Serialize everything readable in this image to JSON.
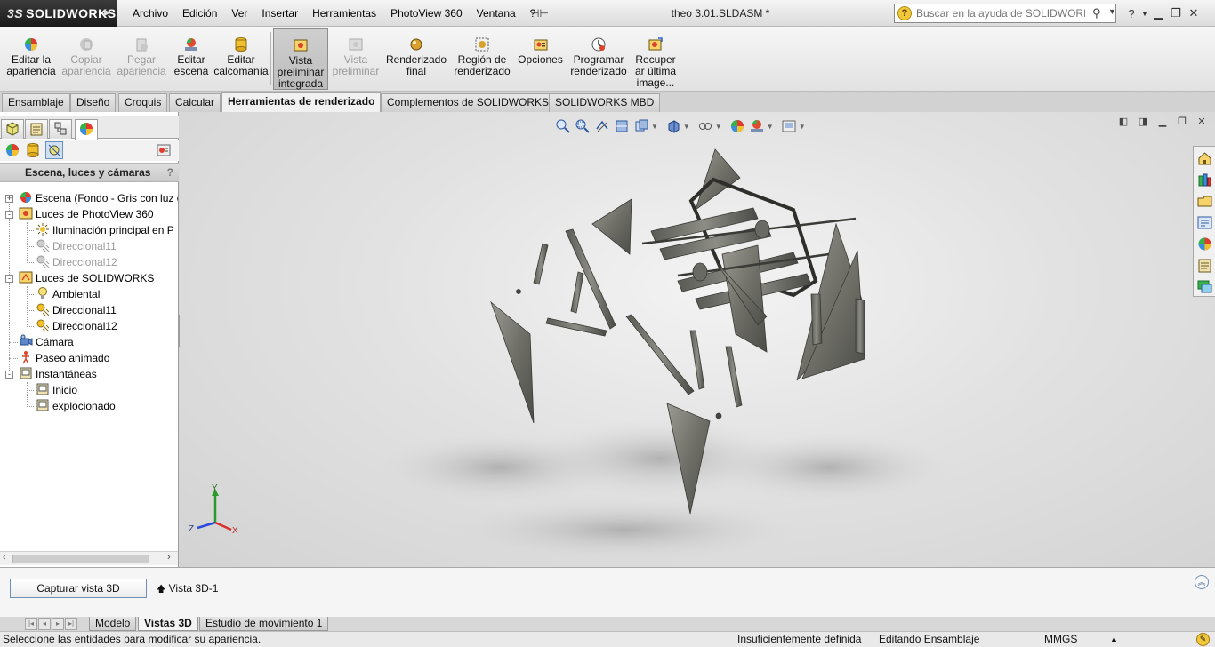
{
  "app": {
    "name": "SOLIDWORKS",
    "brand_prefix": "3S",
    "document_title": "theo 3.01.SLDASM *"
  },
  "menu": [
    "Archivo",
    "Edición",
    "Ver",
    "Insertar",
    "Herramientas",
    "PhotoView 360",
    "Ventana",
    "?"
  ],
  "help_search": {
    "placeholder": "Buscar en la ayuda de SOLIDWORKS"
  },
  "toolbar": {
    "commands": [
      {
        "label": "Editar la apariencia",
        "enabled": true
      },
      {
        "label": "Copiar apariencia",
        "enabled": false
      },
      {
        "label": "Pegar apariencia",
        "enabled": false
      },
      {
        "label": "Editar escena",
        "enabled": true
      },
      {
        "label": "Editar calcomanía",
        "enabled": true
      },
      {
        "label": "Vista preliminar integrada",
        "enabled": true,
        "active": true
      },
      {
        "label": "Vista preliminar",
        "enabled": false
      },
      {
        "label": "Renderizado final",
        "enabled": true
      },
      {
        "label": "Región de renderizado",
        "enabled": true
      },
      {
        "label": "Opciones",
        "enabled": true
      },
      {
        "label": "Programar renderizado",
        "enabled": true
      },
      {
        "label": "Recuper ar última image...",
        "enabled": true
      }
    ]
  },
  "tabs": [
    "Ensamblaje",
    "Diseño",
    "Croquis",
    "Calcular",
    "Herramientas de renderizado",
    "Complementos de SOLIDWORKS",
    "SOLIDWORKS MBD"
  ],
  "active_tab": "Herramientas de renderizado",
  "panel": {
    "title": "Escena, luces y cámaras",
    "help": "?",
    "tree": [
      {
        "label": "Escena (Fondo - Gris con luz c",
        "level": 0,
        "expander": "+",
        "icon": "scene-icon",
        "dimmed": false
      },
      {
        "label": "Luces de PhotoView 360",
        "level": 0,
        "expander": "-",
        "icon": "photoview-lights-icon",
        "dimmed": false
      },
      {
        "label": "Iluminación principal en P",
        "level": 1,
        "icon": "main-light-icon",
        "dimmed": false
      },
      {
        "label": "Direccional11",
        "level": 1,
        "icon": "directional-light-icon",
        "dimmed": true
      },
      {
        "label": "Direccional12",
        "level": 1,
        "icon": "directional-light-icon",
        "dimmed": true
      },
      {
        "label": "Luces de SOLIDWORKS",
        "level": 0,
        "expander": "-",
        "icon": "solidworks-lights-icon",
        "dimmed": false
      },
      {
        "label": "Ambiental",
        "level": 1,
        "icon": "bulb-icon",
        "dimmed": false
      },
      {
        "label": "Direccional11",
        "level": 1,
        "icon": "directional-light-icon",
        "dimmed": false
      },
      {
        "label": "Direccional12",
        "level": 1,
        "icon": "directional-light-icon",
        "dimmed": false
      },
      {
        "label": "Cámara",
        "level": 0,
        "icon": "camera-icon",
        "dimmed": false
      },
      {
        "label": "Paseo animado",
        "level": 0,
        "icon": "walkthrough-icon",
        "dimmed": false
      },
      {
        "label": "Instantáneas",
        "level": 0,
        "expander": "-",
        "icon": "snapshots-icon",
        "dimmed": false
      },
      {
        "label": "Inicio",
        "level": 1,
        "icon": "snapshot-icon",
        "dimmed": false
      },
      {
        "label": "explocionado",
        "level": 1,
        "icon": "snapshot-icon",
        "dimmed": false
      }
    ]
  },
  "viewport": {
    "triad_axes": [
      "Y",
      "Z",
      "X"
    ]
  },
  "bottom_panel": {
    "capture_button": "Capturar vista 3D",
    "view_item": "Vista 3D-1"
  },
  "bottom_tabs": [
    "Modelo",
    "Vistas 3D",
    "Estudio de movimiento 1"
  ],
  "active_bottom_tab": "Vistas 3D",
  "status": {
    "message": "Seleccione las entidades para modificar su apariencia.",
    "definition": "Insuficientemente definida",
    "mode": "Editando Ensamblaje",
    "units": "MMGS"
  },
  "colors": {
    "accent": "#6e8fb8",
    "title_bg": "#1a1a1a",
    "viewport_bg": "#e2e2e2"
  }
}
